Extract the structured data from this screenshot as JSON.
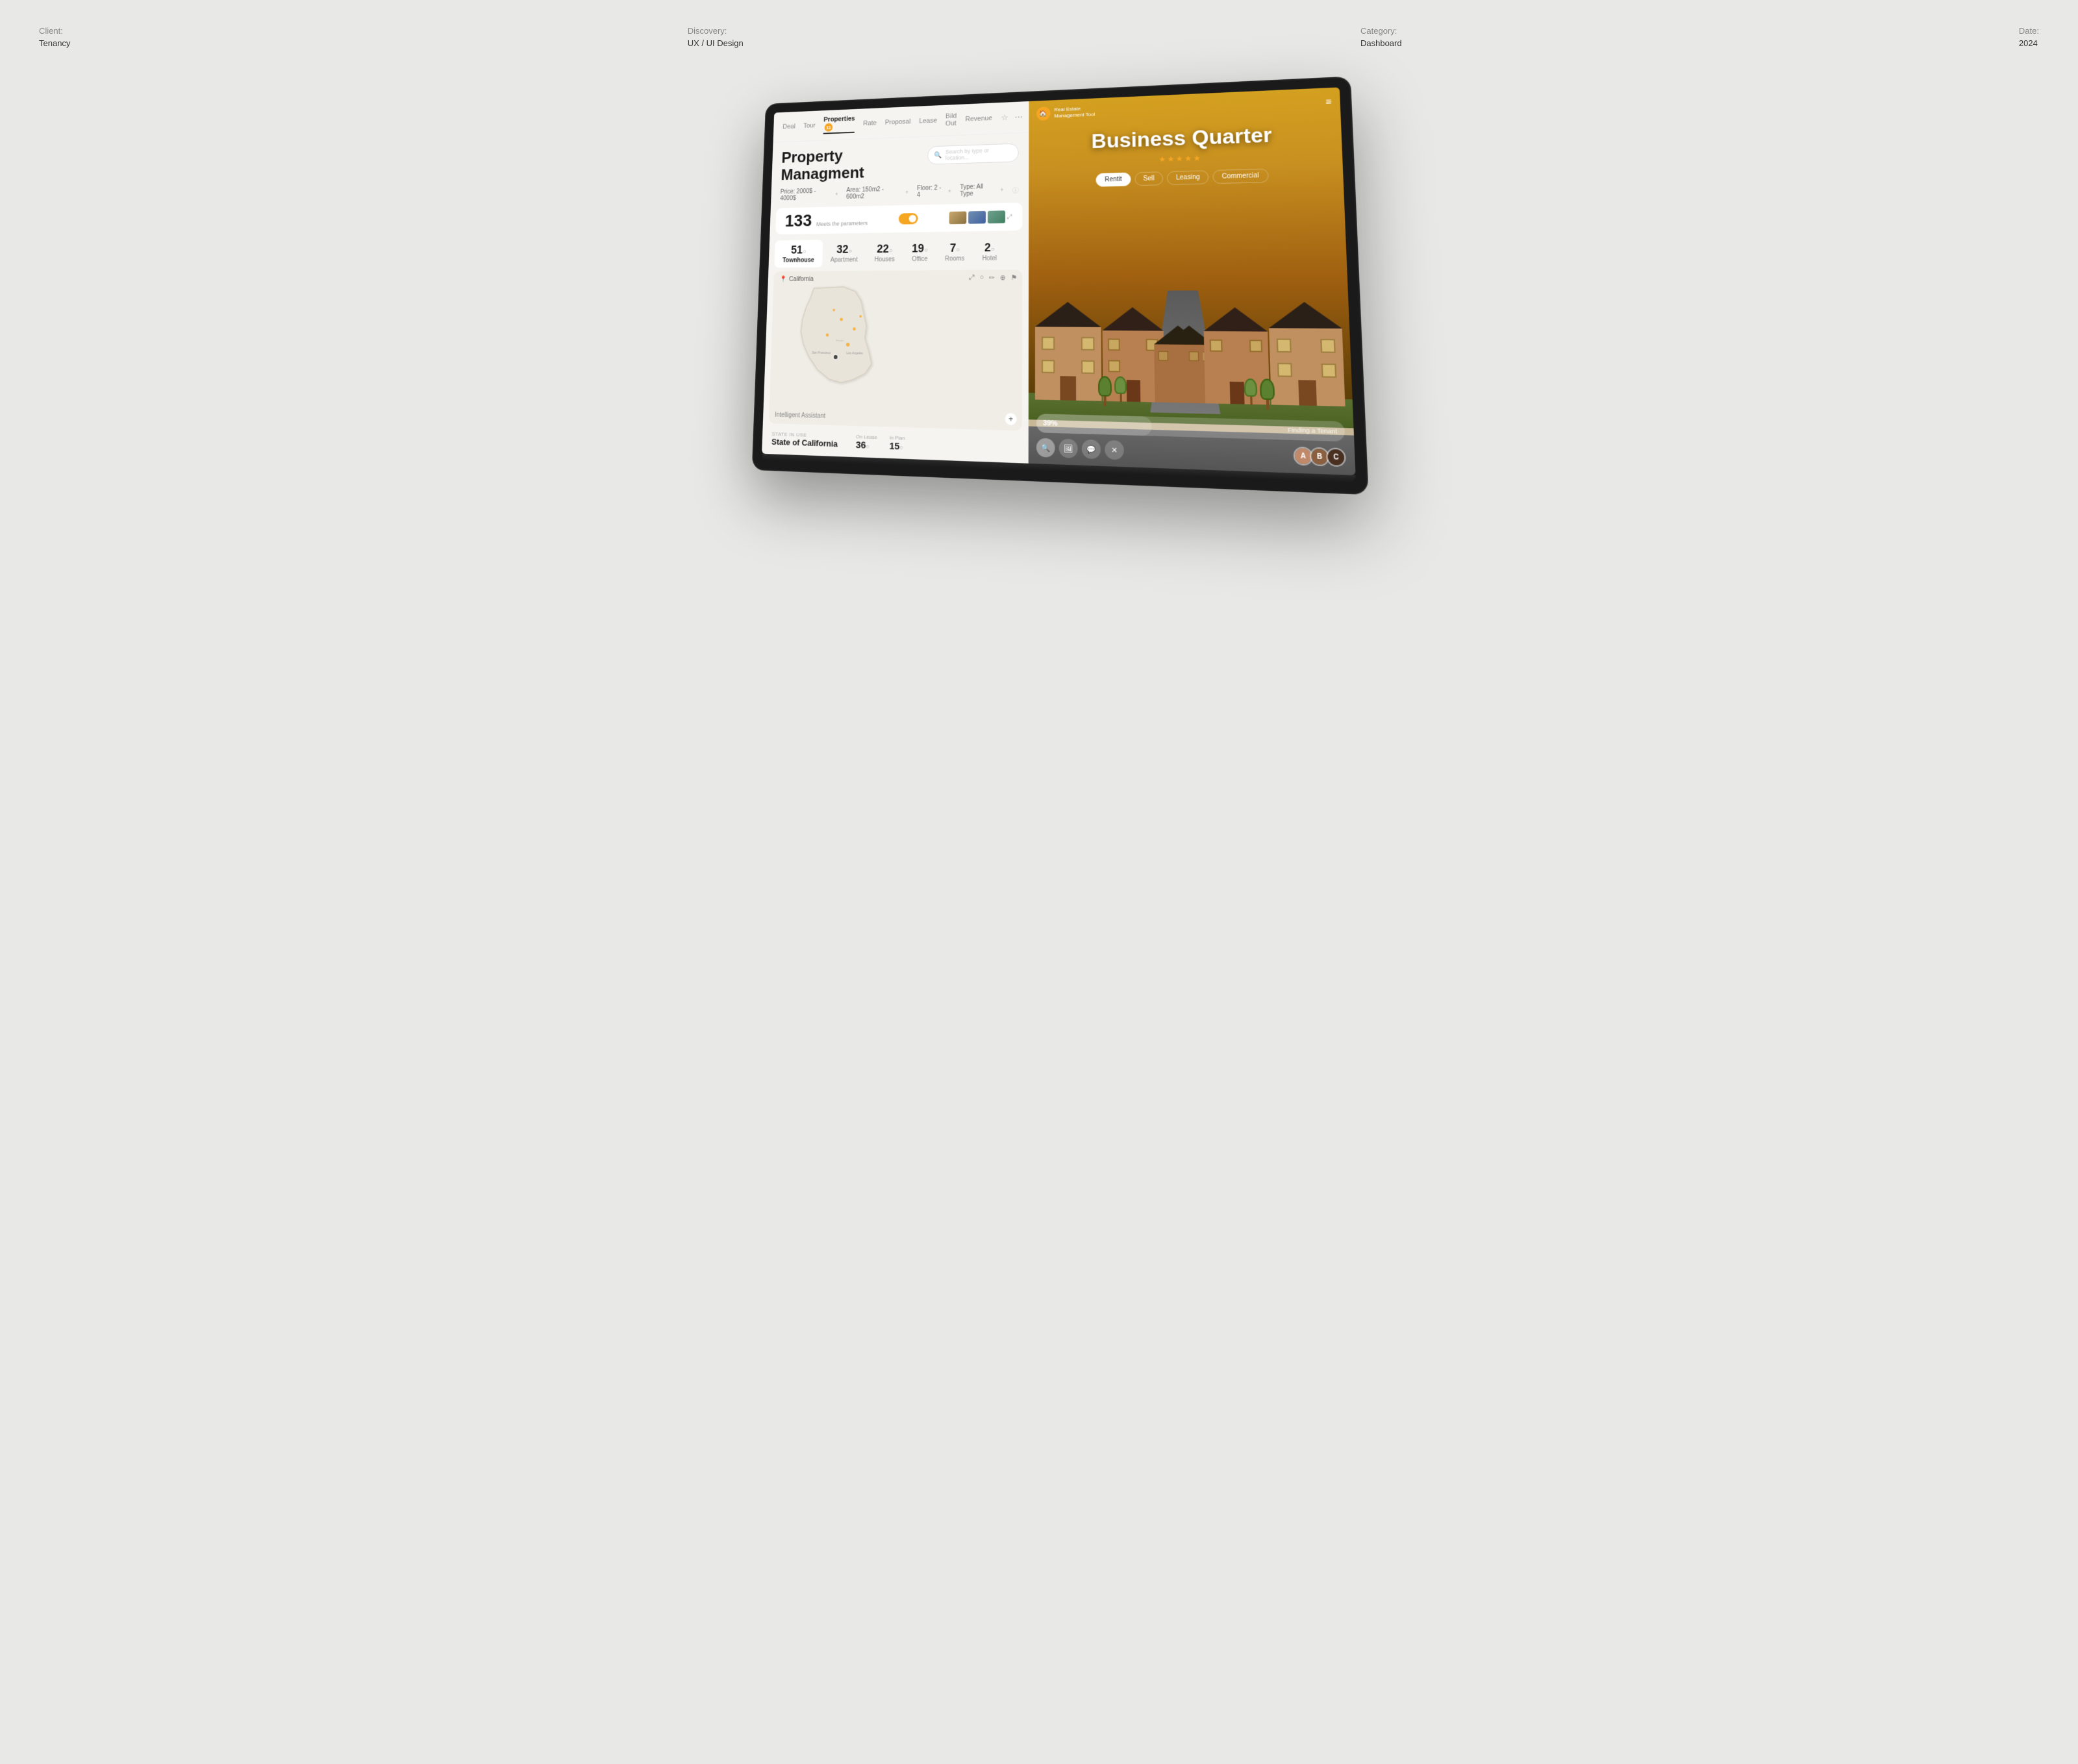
{
  "meta": {
    "client_label": "Client:",
    "client_value": "Tenancy",
    "discovery_label": "Discovery:",
    "discovery_value": "UX / UI Design",
    "category_label": "Category:",
    "category_value": "Dashboard",
    "date_label": "Date:",
    "date_value": "2024"
  },
  "nav": {
    "items": [
      "Deal",
      "Tour",
      "Properties",
      "Rate",
      "Proposal",
      "Lease",
      "Bild Out",
      "Revenue"
    ],
    "active": "Properties",
    "badge": "11",
    "icon_star": "☆",
    "icon_dots": "⋯"
  },
  "panel_left": {
    "title": "Property Managment",
    "search_placeholder": "Search by type or location...",
    "filters": {
      "price": "Price: 2000$ - 4000$",
      "area": "Area: 150m2 - 600m2",
      "floor": "Floor: 2 - 4",
      "type": "Type: All Type"
    },
    "stats": {
      "count": "133",
      "label": "Meets the parameters"
    },
    "property_types": [
      {
        "name": "Townhouse",
        "count": "51",
        "active": true
      },
      {
        "name": "Apartment",
        "count": "32",
        "active": false
      },
      {
        "name": "Houses",
        "count": "22",
        "active": false
      },
      {
        "name": "Office",
        "count": "19",
        "active": false
      },
      {
        "name": "Rooms",
        "count": "7",
        "active": false
      },
      {
        "name": "Hotel",
        "count": "2",
        "active": false
      }
    ],
    "map": {
      "location": "California",
      "zoom_plus": "+"
    },
    "ia_label": "Intelligent Assistant",
    "location_section": {
      "label": "STATE IN USE",
      "name": "State of California",
      "on_lease_label": "On Lease",
      "on_lease_value": "36",
      "in_plan_label": "In Plan",
      "in_plan_value": "15"
    }
  },
  "panel_right": {
    "logo_line1": "Real Estate",
    "logo_line2": "Management Tool",
    "title": "Business Quarter",
    "stars": "★★★★★",
    "tabs": [
      "Rentit",
      "Sell",
      "Leasing",
      "Commercial"
    ],
    "active_tab": "Rentit",
    "progress_percent": "39%",
    "progress_label": "Finding a Tenant",
    "action_icons": [
      "🔍",
      "🖼",
      "💬",
      "✕"
    ],
    "avatars": [
      "A",
      "B",
      "C"
    ]
  }
}
